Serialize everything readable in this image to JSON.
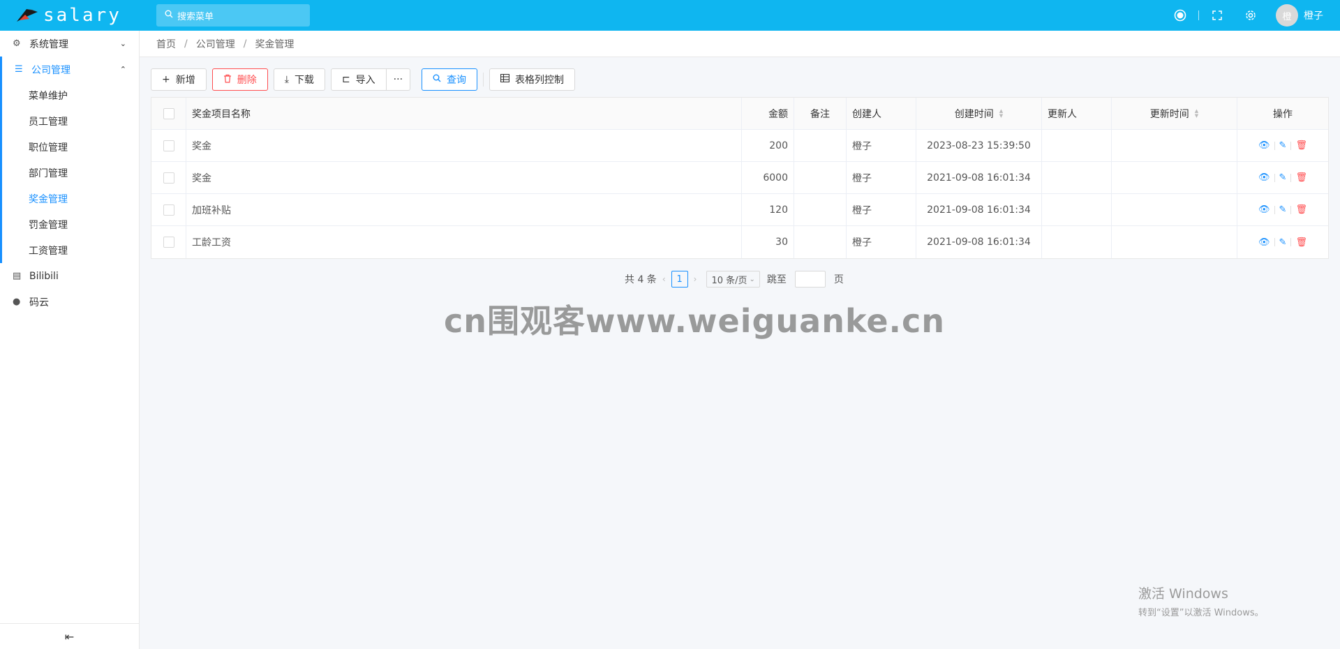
{
  "app": {
    "logo_text": "salary"
  },
  "search": {
    "placeholder": "搜索菜单"
  },
  "user": {
    "avatar_text": "橙",
    "name": "橙子"
  },
  "sidebar": {
    "items": [
      {
        "label": "系统管理",
        "icon": "gears-icon",
        "state": "collapsed"
      },
      {
        "label": "公司管理",
        "icon": "list-icon",
        "state": "expanded"
      }
    ],
    "sub_items": [
      "菜单维护",
      "员工管理",
      "职位管理",
      "部门管理",
      "奖金管理",
      "罚金管理",
      "工资管理"
    ],
    "active_sub": "奖金管理",
    "extra": [
      {
        "label": "Bilibili",
        "icon": "id-card-icon"
      },
      {
        "label": "码云",
        "icon": "github-icon"
      }
    ]
  },
  "breadcrumb": [
    "首页",
    "公司管理",
    "奖金管理"
  ],
  "toolbar": {
    "add": "新增",
    "delete": "删除",
    "download": "下载",
    "import": "导入",
    "more": "···",
    "query": "查询",
    "columns": "表格列控制"
  },
  "table": {
    "headers": [
      "奖金项目名称",
      "金额",
      "备注",
      "创建人",
      "创建时间",
      "更新人",
      "更新时间",
      "操作"
    ],
    "rows": [
      {
        "name": "奖金",
        "amount": "200",
        "note": "",
        "creator": "橙子",
        "created": "2023-08-23 15:39:50",
        "updater": "",
        "updated": ""
      },
      {
        "name": "奖金",
        "amount": "6000",
        "note": "",
        "creator": "橙子",
        "created": "2021-09-08 16:01:34",
        "updater": "",
        "updated": ""
      },
      {
        "name": "加班补贴",
        "amount": "120",
        "note": "",
        "creator": "橙子",
        "created": "2021-09-08 16:01:34",
        "updater": "",
        "updated": ""
      },
      {
        "name": "工龄工资",
        "amount": "30",
        "note": "",
        "creator": "橙子",
        "created": "2021-09-08 16:01:34",
        "updater": "",
        "updated": ""
      }
    ]
  },
  "pagination": {
    "total": "共 4 条",
    "current": "1",
    "page_size": "10 条/页",
    "jump_label": "跳至",
    "page_suffix": "页"
  },
  "watermark": "cn围观客www.weiguanke.cn",
  "windows_activation": {
    "line1": "激活 Windows",
    "line2": "转到“设置”以激活 Windows。"
  },
  "colors": {
    "header": "#0fb6f0",
    "accent": "#1890ff",
    "danger": "#ff4d4f"
  }
}
